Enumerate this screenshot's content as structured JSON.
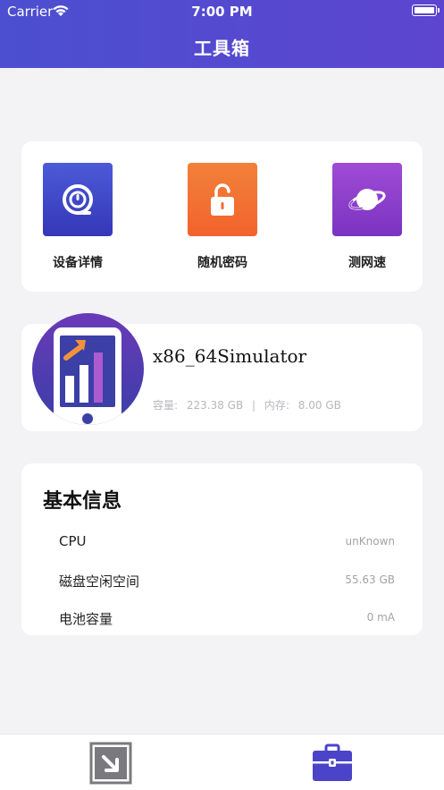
{
  "status_bar": {
    "carrier": "Carrier",
    "time": "7:00 PM"
  },
  "nav": {
    "title": "工具箱"
  },
  "tools": [
    {
      "label": "设备详情",
      "icon": "device-detail-icon",
      "color": "#3f45c6"
    },
    {
      "label": "随机密码",
      "icon": "lock-icon",
      "color": "#f2722f"
    },
    {
      "label": "测网速",
      "icon": "planet-icon",
      "color": "#8d3ecb"
    }
  ],
  "device": {
    "name": "x86_64Simulator",
    "storage_label": "容量:",
    "storage_value": "223.38 GB",
    "separator": "|",
    "memory_label": "内存:",
    "memory_value": "8.00 GB"
  },
  "info": {
    "title": "基本信息",
    "rows": [
      {
        "key": "CPU",
        "value": "unKnown"
      },
      {
        "key": "磁盘空闲空间",
        "value": "55.63 GB"
      },
      {
        "key": "电池容量",
        "value": "0 mA"
      }
    ]
  },
  "tabbar": {
    "tabs": [
      {
        "icon": "export-icon",
        "active": false
      },
      {
        "icon": "toolbox-icon",
        "active": true
      }
    ],
    "active_color": "#4b44c9",
    "inactive_color": "#7a7a7e"
  }
}
